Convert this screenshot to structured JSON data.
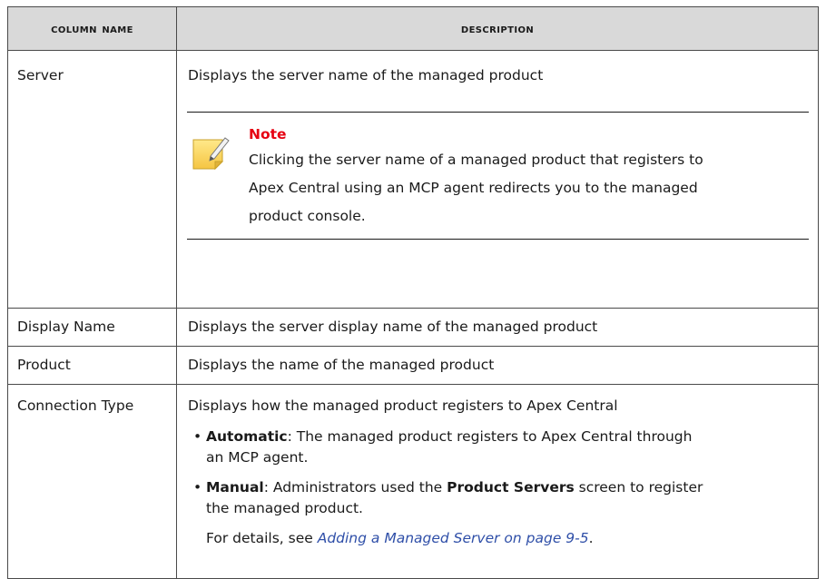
{
  "table": {
    "headers": {
      "col1": "Column Name",
      "col2": "Description"
    },
    "rows": {
      "server": {
        "name": "Server",
        "desc": "Displays the server name of the managed product",
        "note": {
          "title": "Note",
          "text_lines": [
            "Clicking the server name of a managed product that registers to",
            "Apex Central using an MCP agent redirects you to the managed",
            "product console."
          ]
        }
      },
      "display_name": {
        "name": "Display Name",
        "desc": "Displays the server display name of the managed product"
      },
      "product": {
        "name": "Product",
        "desc": "Displays the name of the managed product"
      },
      "connection_type": {
        "name": "Connection Type",
        "desc": "Displays how the managed product registers to Apex Central",
        "options": [
          {
            "term": "Automatic",
            "line1": ": The managed product registers to Apex Central through",
            "line2": "an MCP agent."
          },
          {
            "term": "Manual",
            "pre": ": Administrators used the ",
            "bold": "Product Servers",
            "post": " screen to register",
            "line2": "the managed product."
          }
        ],
        "details_prefix": "For details, see ",
        "details_link": "Adding a Managed Server on page 9-5",
        "details_suffix": "."
      }
    }
  },
  "colors": {
    "header_bg": "#d9d9d9",
    "note_title": "#e60012",
    "link": "#2f4fa8"
  },
  "icons": {
    "note": "note-pencil-icon"
  }
}
